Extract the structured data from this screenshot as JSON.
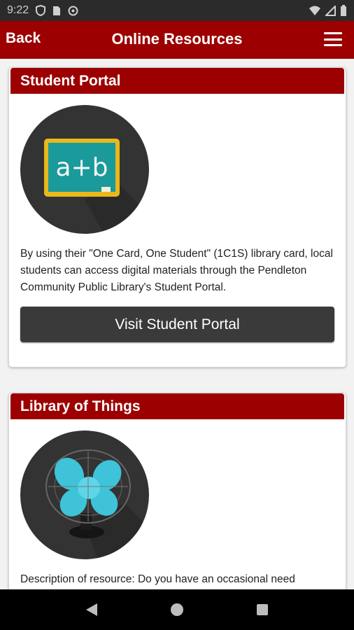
{
  "status_bar": {
    "time": "9:22"
  },
  "app_bar": {
    "back_label": "Back",
    "title": "Online Resources"
  },
  "cards": [
    {
      "title": "Student Portal",
      "icon_text": "a+b",
      "description": "By using their \"One Card, One Student\" (1C1S) library card, local students can access digital materials through the Pendleton Community Public Library's Student Portal.",
      "button_label": "Visit Student Portal"
    },
    {
      "title": "Library of Things",
      "description": "Description of resource: Do you have an occasional need"
    }
  ],
  "colors": {
    "brand": "#9c0000",
    "button": "#3a3a3a",
    "status_bar": "#2b2b2b",
    "chalkboard": "#1a9a9a",
    "fan": "#3ec3d8"
  }
}
